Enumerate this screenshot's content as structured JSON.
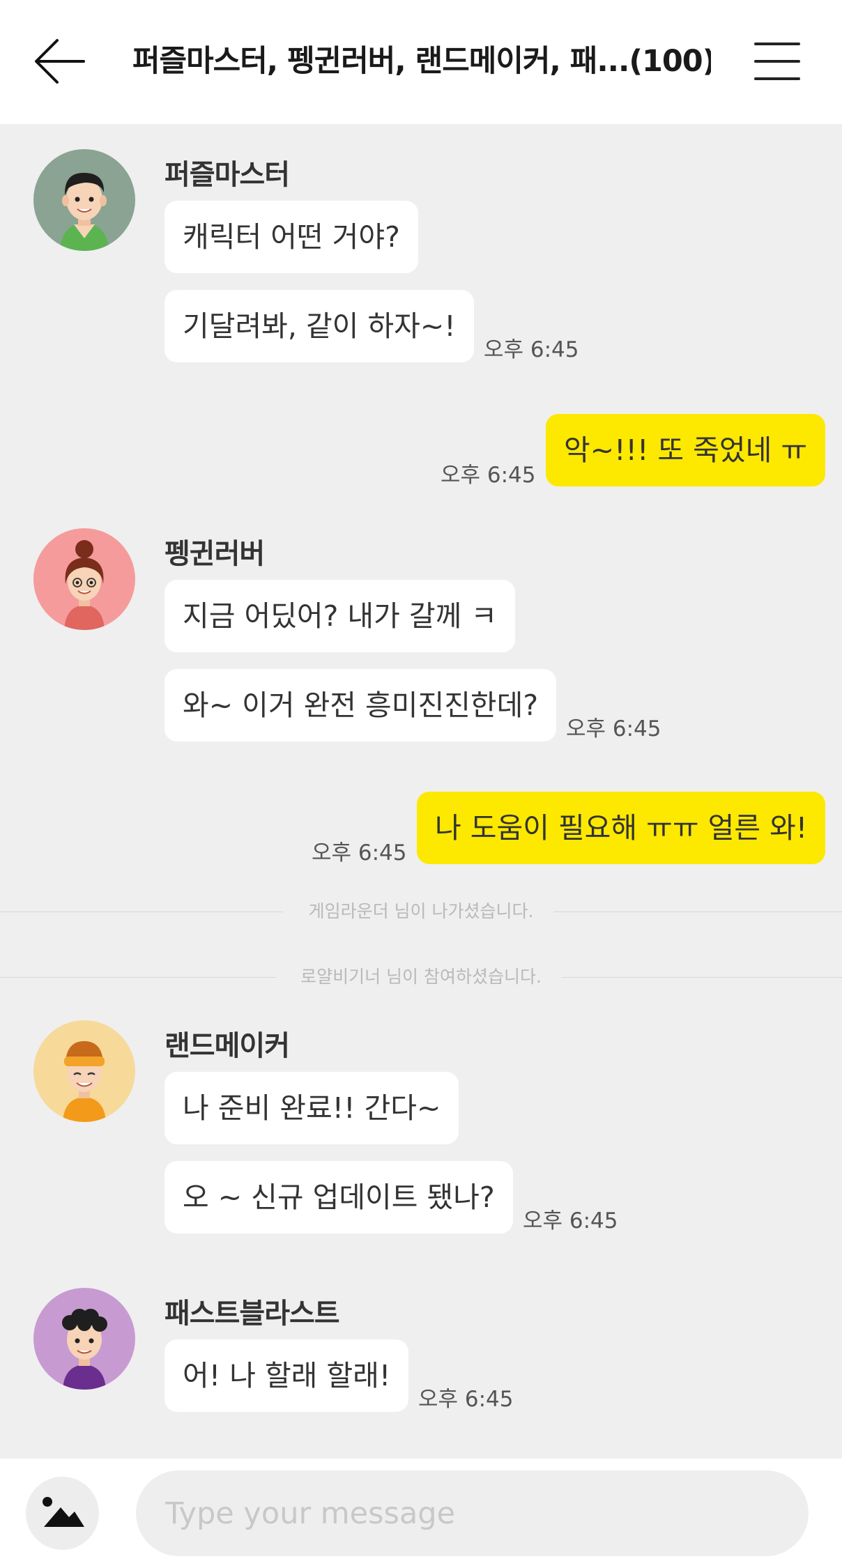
{
  "header": {
    "title": "퍼즐마스터, 펭귄러버, 랜드메이커, 패...(100)",
    "back_icon": "arrow-left-icon",
    "menu_icon": "hamburger-menu-icon"
  },
  "messages": [
    {
      "type": "incoming",
      "sender": "퍼즐마스터",
      "avatar": "boy-green-shirt-avatar",
      "bubbles": [
        "캐릭터 어떤 거야?",
        "기달려봐, 같이 하자~!"
      ],
      "time": "오후 6:45"
    },
    {
      "type": "outgoing",
      "text": "악~!!! 또 죽었네 ㅠ",
      "time": "오후 6:45"
    },
    {
      "type": "incoming",
      "sender": "펭귄러버",
      "avatar": "girl-bun-hair-avatar",
      "bubbles": [
        "지금 어딨어? 내가 갈께 ㅋ",
        "와~ 이거 완전 흥미진진한데?"
      ],
      "time": "오후 6:45"
    },
    {
      "type": "outgoing",
      "text": "나 도움이 필요해 ㅠㅠ 얼른 와!",
      "time": "오후 6:45"
    },
    {
      "type": "system",
      "text": "게임라운더 님이 나가셨습니다."
    },
    {
      "type": "system",
      "text": "로얄비기너 님이 참여하셨습니다."
    },
    {
      "type": "incoming",
      "sender": "랜드메이커",
      "avatar": "boy-headband-avatar",
      "bubbles": [
        "나 준비 완료!! 간다~",
        "오 ~ 신규 업데이트 됐나?"
      ],
      "time": "오후 6:45"
    },
    {
      "type": "incoming",
      "sender": "패스트블라스트",
      "avatar": "boy-curly-hair-avatar",
      "bubbles": [
        "어! 나 할래 할래!"
      ],
      "time": "오후 6:45"
    }
  ],
  "composer": {
    "placeholder": "Type your message",
    "attach_icon": "image-attach-icon"
  },
  "colors": {
    "outgoing_bubble": "#fde800",
    "incoming_bubble": "#ffffff",
    "background": "#efefef"
  }
}
